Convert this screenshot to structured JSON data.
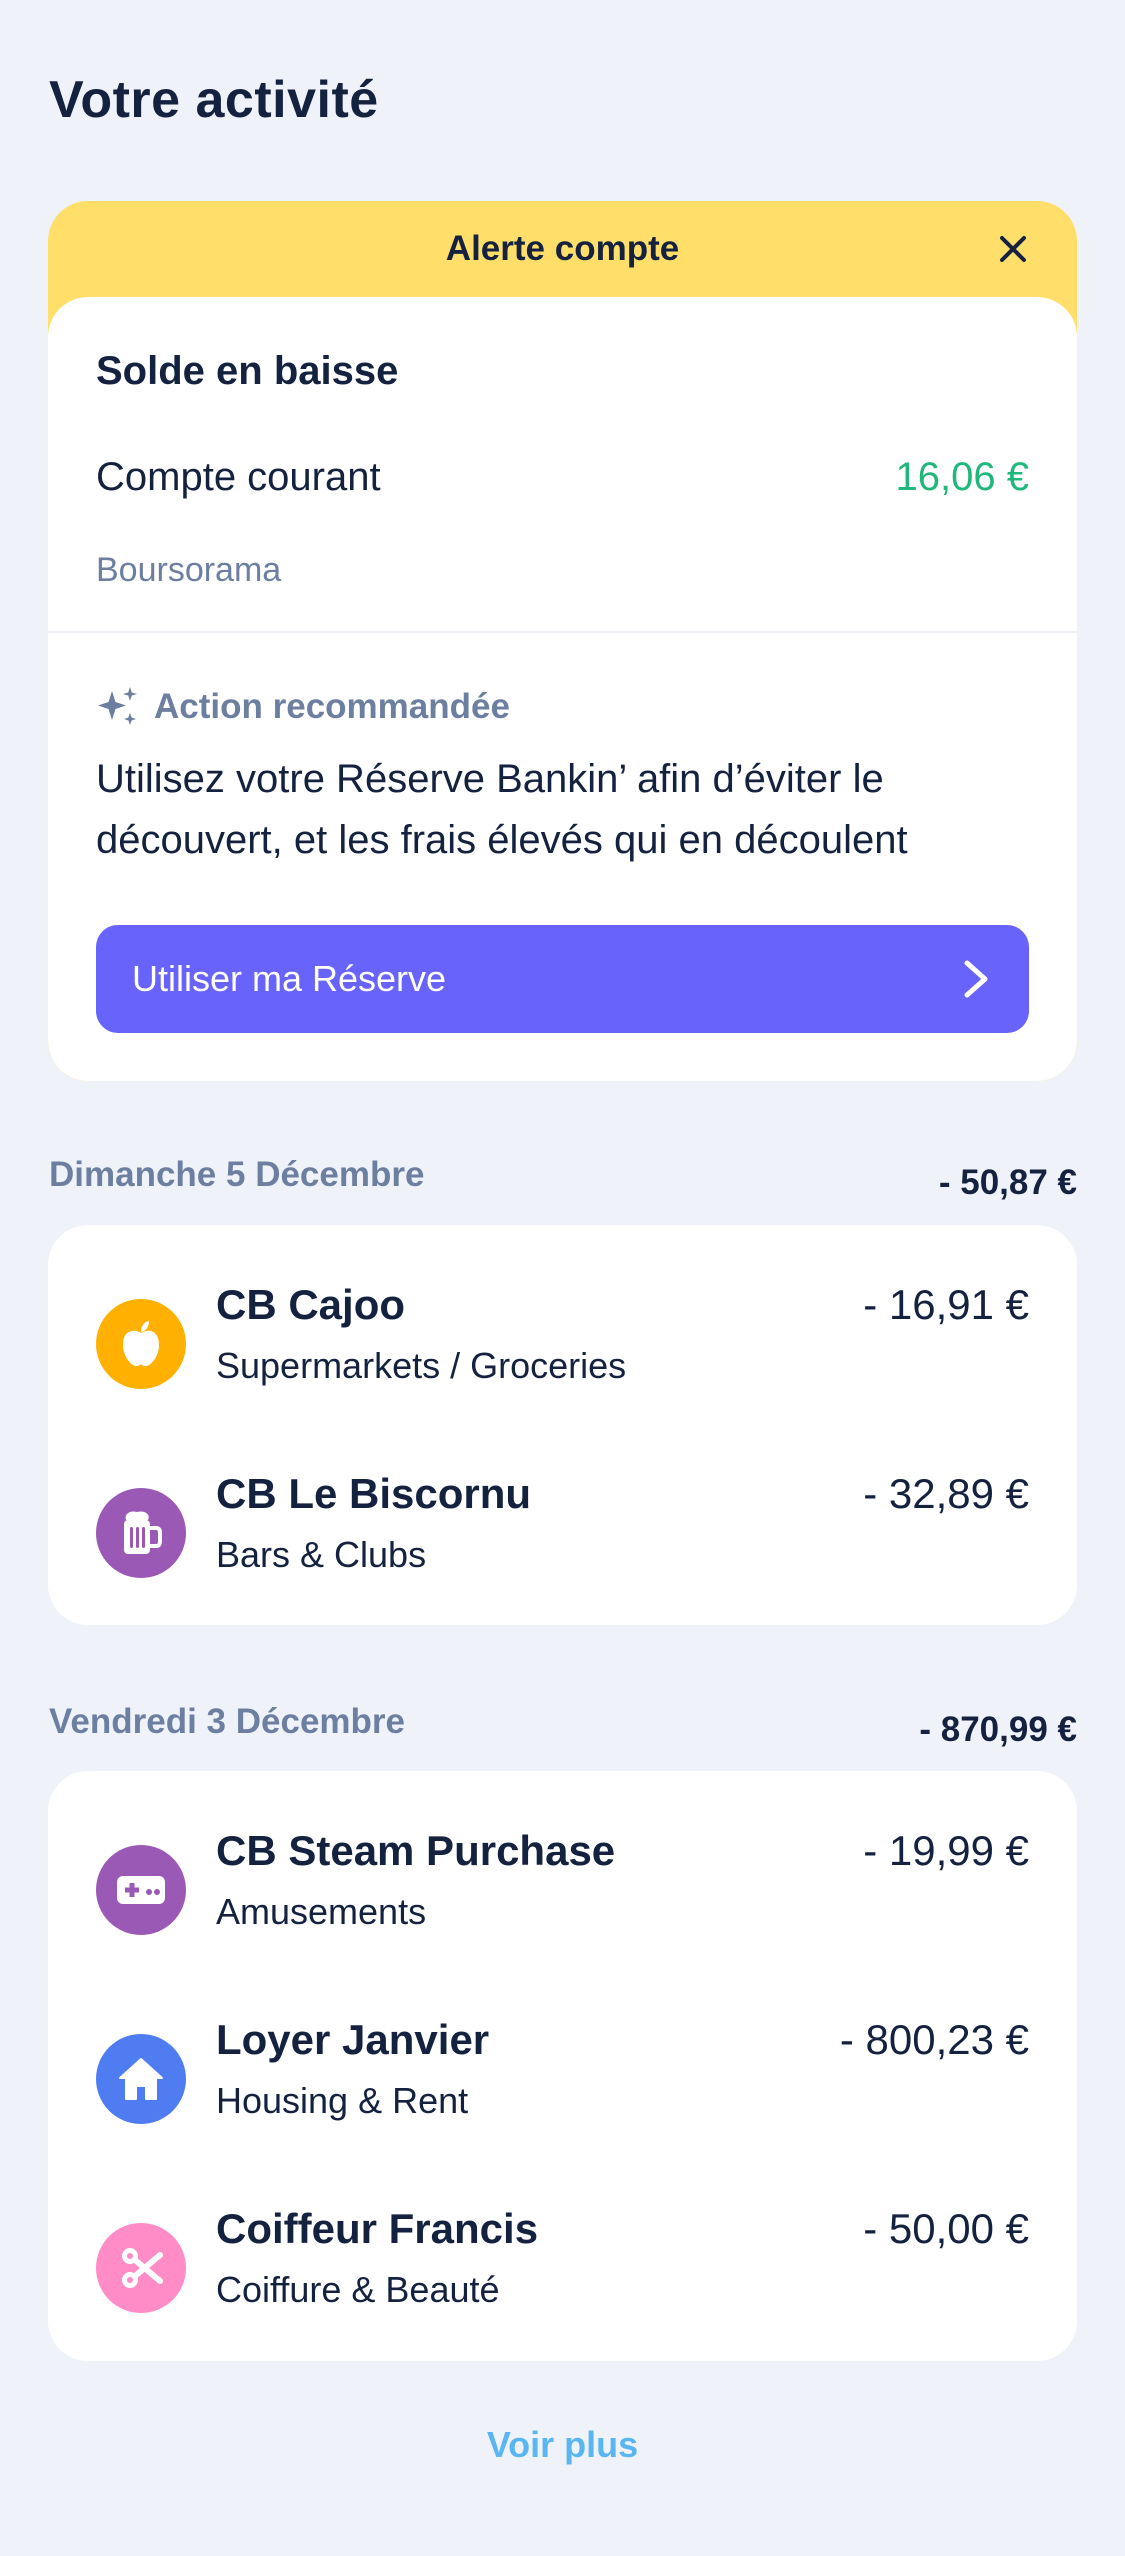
{
  "page": {
    "title": "Votre activité"
  },
  "alert": {
    "header": "Alerte compte",
    "subtitle": "Solde en baisse",
    "account_name": "Compte courant",
    "account_balance": "16,06 €",
    "bank": "Boursorama",
    "recommendation_label": "Action recommandée",
    "recommendation_text": "Utilisez votre Réserve Bankin’ afin d’éviter le découvert, et les frais élevés qui en découlent",
    "cta_label": "Utiliser ma Réserve",
    "colors": {
      "banner": "#ffde6a",
      "cta": "#6763fb",
      "balance": "#1fb87a"
    }
  },
  "groups": [
    {
      "date": "Dimanche 5 Décembre",
      "total": "- 50,87 €",
      "transactions": [
        {
          "name": "CB Cajoo",
          "category": "Supermarkets / Groceries",
          "amount": "- 16,91 €",
          "icon": "apple-icon",
          "color": "#ffb000"
        },
        {
          "name": "CB Le Biscornu",
          "category": "Bars & Clubs",
          "amount": "- 32,89 €",
          "icon": "beer-mug-icon",
          "color": "#9b59b6"
        }
      ]
    },
    {
      "date": "Vendredi 3 Décembre",
      "total": "- 870,99 €",
      "transactions": [
        {
          "name": "CB Steam Purchase",
          "category": "Amusements",
          "amount": "- 19,99 €",
          "icon": "gamepad-icon",
          "color": "#9b59b6"
        },
        {
          "name": "Loyer Janvier",
          "category": "Housing & Rent",
          "amount": "- 800,23 €",
          "icon": "house-icon",
          "color": "#4f7cf0"
        },
        {
          "name": "Coiffeur Francis",
          "category": "Coiffure & Beauté",
          "amount": "- 50,00 €",
          "icon": "scissors-icon",
          "color": "#ff8cc6"
        }
      ]
    }
  ],
  "see_more": "Voir plus"
}
